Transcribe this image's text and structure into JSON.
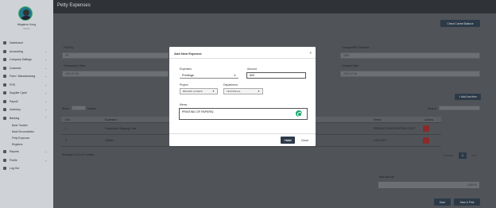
{
  "sidebar": {
    "user_name": "Megatron Kong",
    "user_role": "Admin",
    "items": [
      {
        "label": "Dashboard",
        "chevron": false
      },
      {
        "label": "Accounting",
        "chevron": true
      },
      {
        "label": "Company Settings",
        "chevron": true
      },
      {
        "label": "Customer",
        "chevron": true
      },
      {
        "label": "Farm / Manufacturing",
        "chevron": true
      },
      {
        "label": "POS",
        "chevron": true
      },
      {
        "label": "Supplier Cycle",
        "chevron": true
      },
      {
        "label": "Payroll",
        "chevron": true
      },
      {
        "label": "Inventory",
        "chevron": true
      },
      {
        "label": "Banking",
        "chevron": true
      }
    ],
    "banking_sub": [
      "Bank Transfer",
      "Bank Reconciliation",
      "Petty Expenses",
      "Registers"
    ],
    "bottom_items": [
      {
        "label": "Reports",
        "chevron": true
      },
      {
        "label": "Profile",
        "chevron": true
      },
      {
        "label": "Log Out",
        "chevron": false
      }
    ]
  },
  "header": {
    "title": "Petty Expenses",
    "check_balance_button": "Check Current Balance"
  },
  "form_bg": {
    "paid_by_label": "Paid By",
    "paid_by_value": "SS",
    "transaction_date_label": "Transaction Date",
    "transaction_date_value": "2021-07-06",
    "cheque_label": "Cheque/REF Number",
    "cheque_value": "3284",
    "cheque_date_label": "Cheque Date",
    "cheque_date_value": "2021-07-06"
  },
  "add_line_button": "+ Add Line Item",
  "table": {
    "show_label": "Show",
    "entries_label": "entries",
    "search_label": "Search:",
    "columns": [
      "S/N",
      "Expenses",
      "Memo",
      "Actions"
    ],
    "rows": [
      {
        "sn": "1",
        "expense": "Freight and Shipping Cost",
        "memo": "FREIGHTS AND SHIPPING COST"
      },
      {
        "sn": "2",
        "expense": "Utilities",
        "memo": "UTILITIES"
      }
    ],
    "showing_text": "Showing 1 to 2 of 2 entries",
    "prev": "Previous",
    "page": "1",
    "next": "Next"
  },
  "totals": {
    "label": "Total Amount",
    "value": "1,800.00"
  },
  "footer": {
    "save_button": "Save",
    "save_print_button": "Save & Print"
  },
  "modal": {
    "title": "Add New Expense",
    "close_icon": "×",
    "expense_label": "Expenses",
    "expense_value": "Printings",
    "amount_label": "Amount",
    "amount_value": "800",
    "project_label": "Project",
    "project_value": "BROWN LAYERS",
    "department_label": "Department",
    "department_value": "TECHNICAL",
    "memo_label": "Memo",
    "memo_value": "PRINTING OF PAPERS|",
    "add_button": "+Add",
    "close_button": "Close"
  },
  "colors": {
    "accent": "#2c3a48",
    "grammar": "#1aaa6d",
    "delete": "#8a2a2a"
  }
}
